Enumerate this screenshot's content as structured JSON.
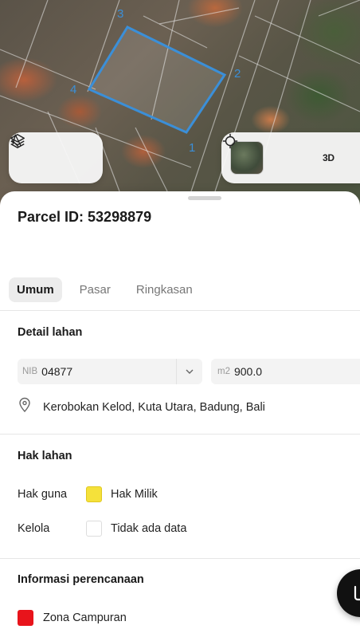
{
  "map": {
    "vertex_labels": [
      "3",
      "2",
      "4",
      "1"
    ],
    "parcel_outline_color": "#3b8fd8",
    "controls": {
      "layers_icon": "layers-icon",
      "draw_icon": "draw-polygon-icon",
      "basemap_icon": "satellite-basemap-thumbnail",
      "locate_icon": "crosshair-icon",
      "three_d_label": "3D"
    }
  },
  "sheet": {
    "parcel_title": "Parcel ID: 53298879",
    "tabs": [
      {
        "label": "Umum",
        "active": true
      },
      {
        "label": "Pasar",
        "active": false
      },
      {
        "label": "Ringkasan",
        "active": false
      }
    ],
    "detail": {
      "title": "Detail lahan",
      "nib_prefix": "NIB",
      "nib_value": "04877",
      "area_unit": "m2",
      "area_value": "900.0",
      "location_icon": "location-pin-icon",
      "location": "Kerobokan Kelod, Kuta Utara, Badung, Bali"
    },
    "hak": {
      "title": "Hak lahan",
      "rows": [
        {
          "label": "Hak guna",
          "value": "Hak Milik",
          "color": "#f5e13a"
        },
        {
          "label": "Kelola",
          "value": "Tidak ada data",
          "color": "#ffffff"
        }
      ]
    },
    "planning": {
      "title": "Informasi perencanaan",
      "zone": "Zona Campuran",
      "zone_color": "#e8141b"
    },
    "chat_icon": "chat-bubble-icon"
  }
}
